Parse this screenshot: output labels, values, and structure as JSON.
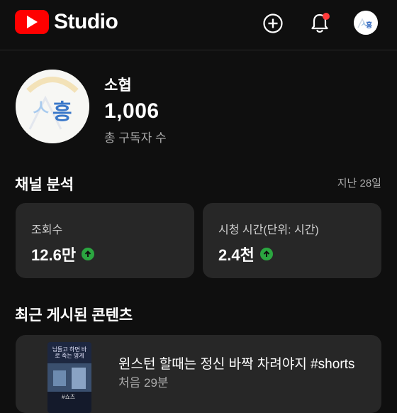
{
  "app": {
    "name": "Studio"
  },
  "icons": {
    "logo": "youtube-play-icon",
    "create": "add-circle-icon",
    "notifications": "bell-icon",
    "accent_red": "#ff0000",
    "trend_green": "#2ba640"
  },
  "channel": {
    "name": "소협",
    "subscriber_count": "1,006",
    "subscriber_label": "총 구독자 수",
    "avatar_text": "ㅅ흥"
  },
  "analytics": {
    "title": "채널 분석",
    "period": "지난 28일",
    "stats": [
      {
        "label": "조회수",
        "value": "12.6만",
        "trend": "up"
      },
      {
        "label": "시청 시간(단위: 시간)",
        "value": "2.4천",
        "trend": "up"
      }
    ]
  },
  "recent": {
    "title": "최근 게시된 콘텐츠",
    "item": {
      "title": "윈스턴 할때는 정신 바짝 차려야지 #shorts",
      "meta": "처음 29분",
      "thumb_text": "님들고 하면 바로 죽는 명게",
      "thumb_tag": "#쇼츠"
    }
  }
}
